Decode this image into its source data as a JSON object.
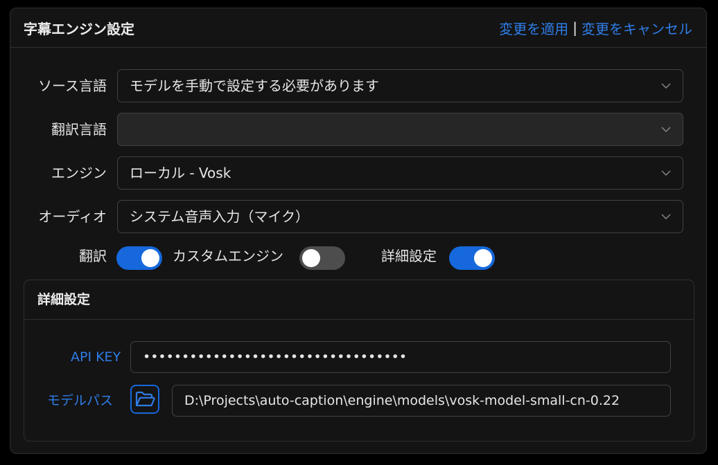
{
  "header": {
    "title": "字幕エンジン設定",
    "apply_label": "変更を適用",
    "separator": "|",
    "cancel_label": "変更をキャンセル"
  },
  "fields": {
    "source_language": {
      "label": "ソース言語",
      "value": "モデルを手動で設定する必要があります"
    },
    "translation_language": {
      "label": "翻訳言語",
      "value": ""
    },
    "engine": {
      "label": "エンジン",
      "value": "ローカル - Vosk"
    },
    "audio": {
      "label": "オーディオ",
      "value": "システム音声入力（マイク）"
    }
  },
  "toggles": {
    "translation": {
      "label": "翻訳",
      "on": true
    },
    "custom_engine": {
      "label": "カスタムエンジン",
      "on": false
    },
    "advanced": {
      "label": "詳細設定",
      "on": true
    }
  },
  "advanced": {
    "title": "詳細設定",
    "api_key_label": "API KEY",
    "api_key_value": "••••••••••••••••••••••••••••••••••",
    "model_path_label": "モデルパス",
    "model_path_value": "D:\\Projects\\auto-caption\\engine\\models\\vosk-model-small-cn-0.22"
  },
  "icons": {
    "dropdown": "chevron-down-icon",
    "folder": "folder-open-icon"
  },
  "colors": {
    "accent": "#1668dc",
    "link": "#2f7de8",
    "background": "#141414",
    "border": "#303030"
  }
}
